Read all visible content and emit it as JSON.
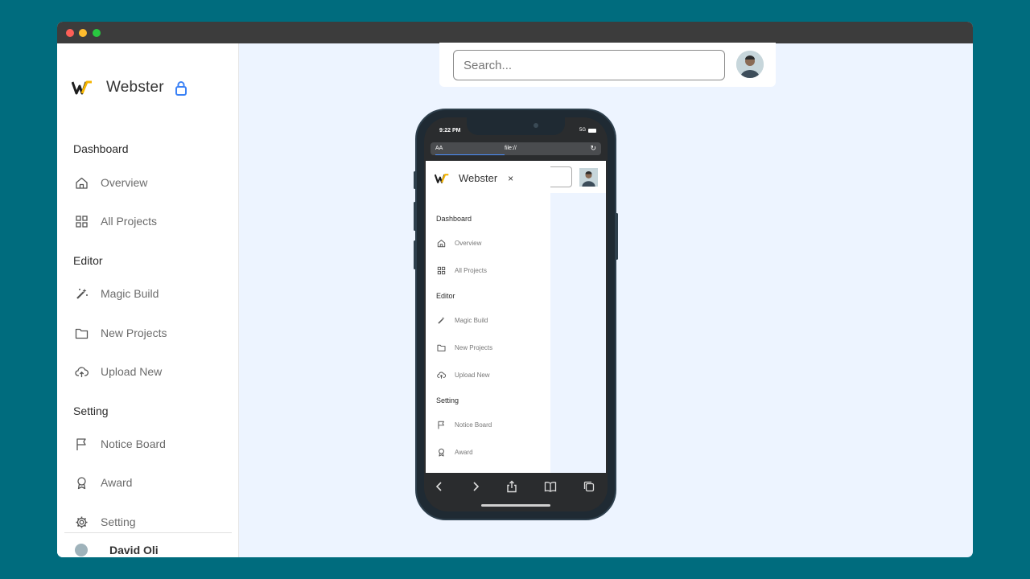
{
  "app": {
    "brand": "Webster",
    "brand_short": "W",
    "colors": {
      "background": "#006c7e",
      "accent": "#3b82f6",
      "logo_yellow": "#f5b400",
      "content_bg": "#edf4ff"
    }
  },
  "sidebar": {
    "sections": [
      {
        "title": "Dashboard",
        "items": [
          {
            "label": "Overview",
            "icon": "home-icon"
          },
          {
            "label": "All Projects",
            "icon": "grid-icon"
          }
        ]
      },
      {
        "title": "Editor",
        "items": [
          {
            "label": "Magic Build",
            "icon": "magic-wand-icon"
          },
          {
            "label": "New Projects",
            "icon": "folder-icon"
          },
          {
            "label": "Upload New",
            "icon": "cloud-upload-icon"
          }
        ]
      },
      {
        "title": "Setting",
        "items": [
          {
            "label": "Notice Board",
            "icon": "flag-icon"
          },
          {
            "label": "Award",
            "icon": "award-icon"
          },
          {
            "label": "Setting",
            "icon": "gear-icon"
          }
        ]
      }
    ],
    "profile_name": "David Oli"
  },
  "topbar": {
    "search_placeholder": "Search..."
  },
  "phone": {
    "time": "9:22 PM",
    "network": "5G",
    "url_aa": "AA",
    "url": "file://",
    "menu": {
      "brand": "Webster",
      "close": "×",
      "sections": [
        {
          "title": "Dashboard",
          "items": [
            {
              "label": "Overview"
            },
            {
              "label": "All Projects"
            }
          ]
        },
        {
          "title": "Editor",
          "items": [
            {
              "label": "Magic Build"
            },
            {
              "label": "New Projects"
            },
            {
              "label": "Upload New"
            }
          ]
        },
        {
          "title": "Setting",
          "items": [
            {
              "label": "Notice Board"
            },
            {
              "label": "Award"
            }
          ]
        }
      ]
    }
  }
}
